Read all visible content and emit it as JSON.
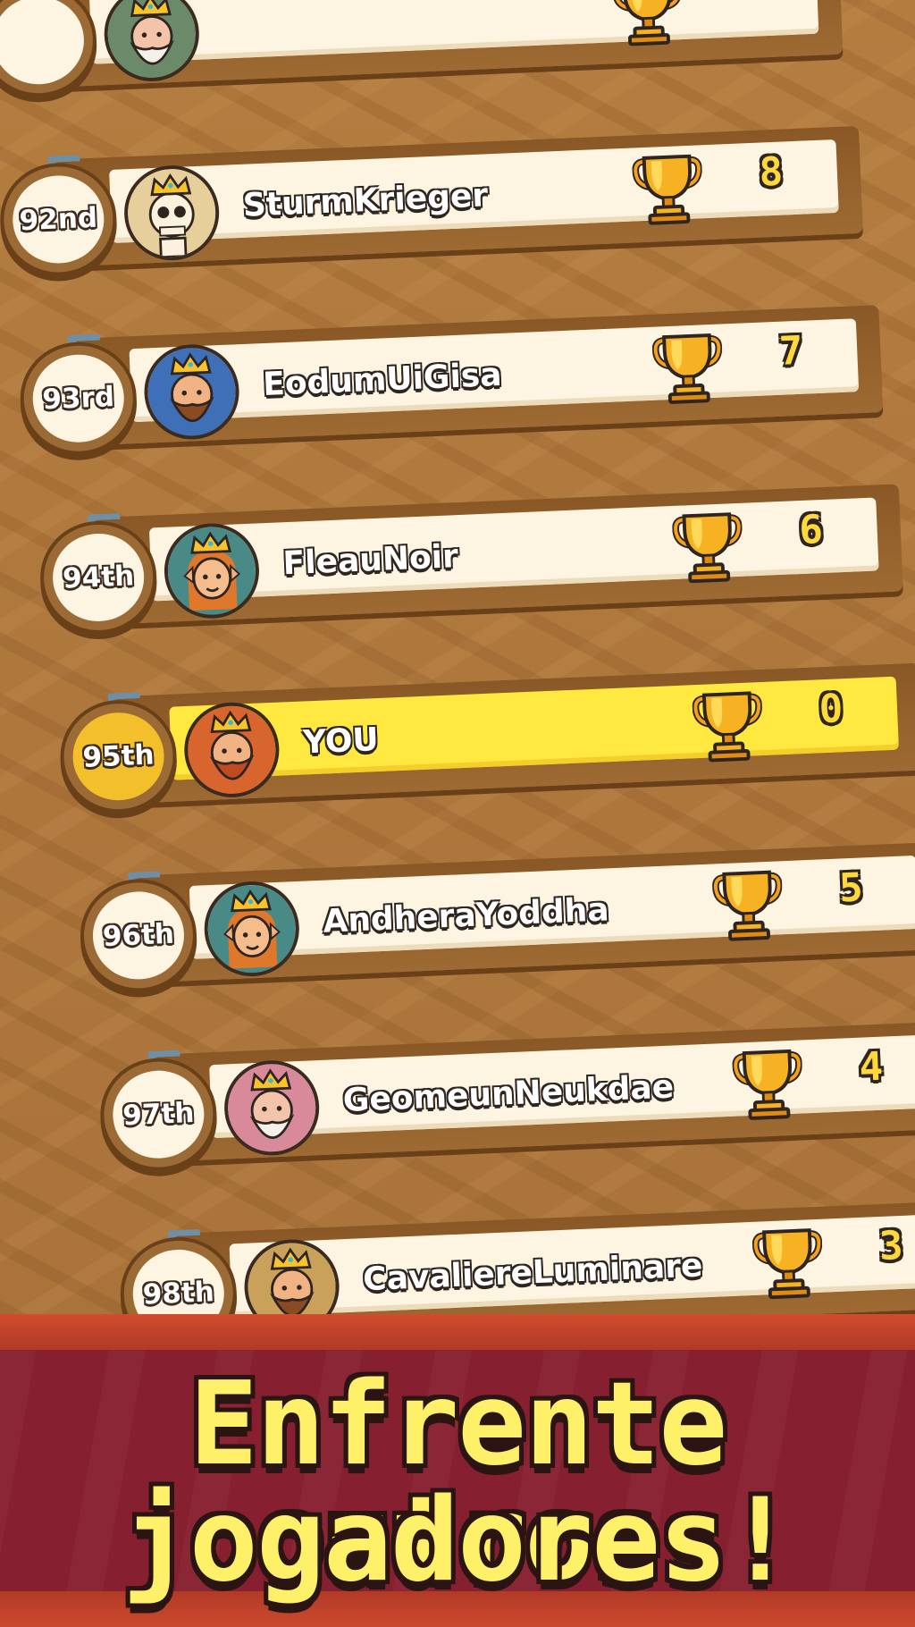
{
  "leaderboard": {
    "rows": [
      {
        "rank": "",
        "name": "",
        "score": "",
        "avatar": "elder",
        "is_me": false
      },
      {
        "rank": "92nd",
        "name": "SturmKrieger",
        "score": "8",
        "avatar": "skeleton-king",
        "is_me": false
      },
      {
        "rank": "93rd",
        "name": "EodumUiGisa",
        "score": "7",
        "avatar": "bald-dwarf-king",
        "is_me": false
      },
      {
        "rank": "94th",
        "name": "FleauNoir",
        "score": "6",
        "avatar": "elf-queen",
        "is_me": false
      },
      {
        "rank": "95th",
        "name": "YOU",
        "score": "0",
        "avatar": "bearded-king",
        "is_me": true
      },
      {
        "rank": "96th",
        "name": "AndheraYoddha",
        "score": "5",
        "avatar": "elf-queen",
        "is_me": false
      },
      {
        "rank": "97th",
        "name": "GeomeunNeukdae",
        "score": "4",
        "avatar": "elder-king",
        "is_me": false
      },
      {
        "rank": "98th",
        "name": "CavaliereLuminare",
        "score": "3",
        "avatar": "dwarf-king",
        "is_me": false
      }
    ]
  },
  "banner": {
    "line1": "Enfrente outros",
    "line2": "jogadores!"
  },
  "icons": {
    "trophy": "trophy-icon",
    "crown": "crown-icon"
  },
  "colors": {
    "highlight": "#ffe83f",
    "score": "#ffd93a",
    "banner": "#861f30",
    "headline": "#fff06a"
  }
}
